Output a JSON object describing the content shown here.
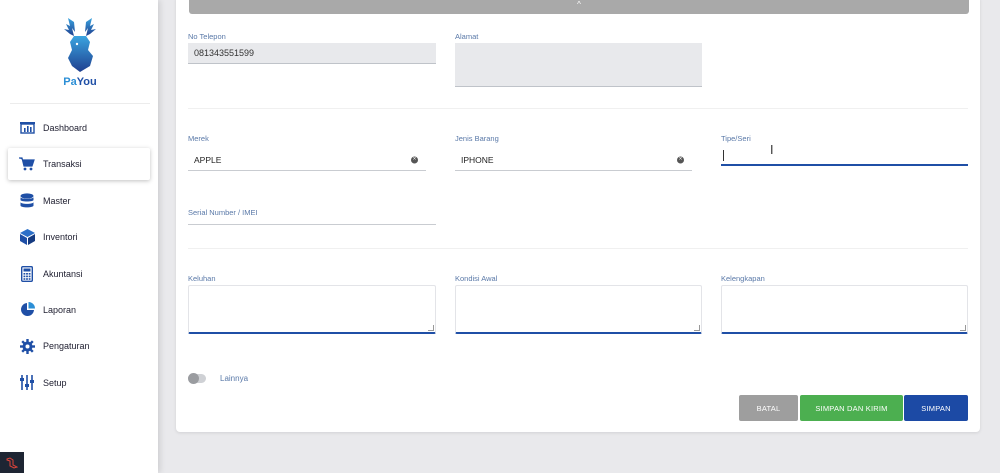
{
  "sidebar": {
    "logo_text": "PaYou",
    "items": [
      {
        "label": "Dashboard",
        "icon": "dashboard-icon"
      },
      {
        "label": "Transaksi",
        "icon": "cart-icon"
      },
      {
        "label": "Master",
        "icon": "database-icon"
      },
      {
        "label": "Inventori",
        "icon": "cube-icon"
      },
      {
        "label": "Akuntansi",
        "icon": "calculator-icon"
      },
      {
        "label": "Laporan",
        "icon": "pie-chart-icon"
      },
      {
        "label": "Pengaturan",
        "icon": "gear-icon"
      },
      {
        "label": "Setup",
        "icon": "sliders-icon"
      }
    ],
    "active": "Transaksi"
  },
  "form": {
    "no_telepon": {
      "label": "No Telepon",
      "value": "081343551599"
    },
    "alamat": {
      "label": "Alamat",
      "value": ""
    },
    "merek": {
      "label": "Merek",
      "value": "APPLE"
    },
    "jenis_barang": {
      "label": "Jenis Barang",
      "value": "IPHONE"
    },
    "tipe_seri": {
      "label": "Tipe/Seri",
      "value": ""
    },
    "serial": {
      "label": "Serial Number / IMEI",
      "value": ""
    },
    "keluhan": {
      "label": "Keluhan",
      "value": ""
    },
    "kondisi_awal": {
      "label": "Kondisi Awal",
      "value": ""
    },
    "kelengkapan": {
      "label": "Kelengkapan",
      "value": ""
    },
    "lainnya": {
      "label": "Lainnya",
      "checked": false
    }
  },
  "buttons": {
    "batal": "BATAL",
    "simpan_kirim": "SIMPAN DAN KIRIM",
    "simpan": "SIMPAN"
  },
  "colors": {
    "accent": "#1f4fa6",
    "success": "#4caf50",
    "neutral": "#9e9e9e"
  }
}
